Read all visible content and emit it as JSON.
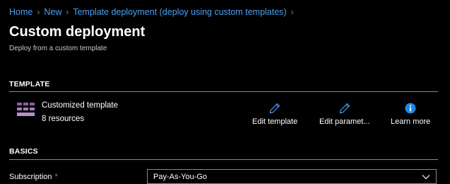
{
  "breadcrumb": {
    "items": [
      "Home",
      "New",
      "Template deployment (deploy using custom templates)"
    ]
  },
  "page": {
    "title": "Custom deployment",
    "subtitle": "Deploy from a custom template"
  },
  "template_section": {
    "heading": "TEMPLATE",
    "name": "Customized template",
    "resources": "8 resources",
    "icon": "template-grid-icon",
    "actions": [
      {
        "label": "Edit template",
        "icon": "pencil-icon"
      },
      {
        "label": "Edit paramet...",
        "icon": "pencil-icon"
      },
      {
        "label": "Learn more",
        "icon": "info-icon"
      }
    ]
  },
  "basics_section": {
    "heading": "BASICS",
    "subscription_label": "Subscription",
    "required_marker": "*",
    "subscription_value": "Pay-As-You-Go"
  },
  "colors": {
    "background": "#000000",
    "link": "#4aa0f0",
    "accent": "#1e88e5",
    "icon_purple": "#8e5ba6",
    "required": "#ff5c5c"
  }
}
